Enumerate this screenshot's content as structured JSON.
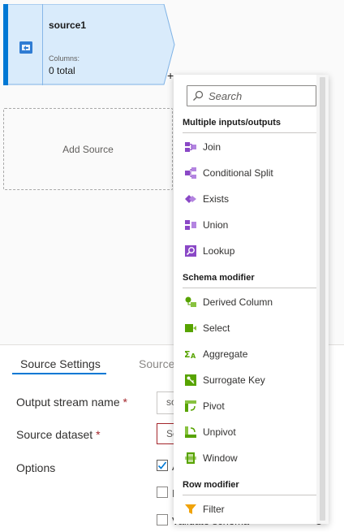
{
  "canvas": {
    "node": {
      "title": "source1",
      "columns_label": "Columns:",
      "columns_value": "0 total"
    },
    "add_node_glyph": "+",
    "add_source_label": "Add Source"
  },
  "settings": {
    "tabs": [
      {
        "label": "Source Settings"
      },
      {
        "label": "Source"
      }
    ],
    "fields": {
      "output_stream_name": {
        "label": "Output stream name",
        "required": "*",
        "value": "so"
      },
      "source_dataset": {
        "label": "Source dataset",
        "required": "*",
        "value": "Se"
      },
      "options": {
        "label": "Options"
      }
    },
    "checkboxes": [
      {
        "label": "A",
        "checked": true
      },
      {
        "label": "I",
        "checked": false
      },
      {
        "label": "Validate schema",
        "checked": false
      }
    ]
  },
  "menu": {
    "search_placeholder": "Search",
    "sections": [
      {
        "header": "Multiple inputs/outputs",
        "items": [
          {
            "label": "Join",
            "icon": "join-icon"
          },
          {
            "label": "Conditional Split",
            "icon": "conditional-split-icon"
          },
          {
            "label": "Exists",
            "icon": "exists-icon"
          },
          {
            "label": "Union",
            "icon": "union-icon"
          },
          {
            "label": "Lookup",
            "icon": "lookup-icon"
          }
        ]
      },
      {
        "header": "Schema modifier",
        "items": [
          {
            "label": "Derived Column",
            "icon": "derived-column-icon"
          },
          {
            "label": "Select",
            "icon": "select-icon"
          },
          {
            "label": "Aggregate",
            "icon": "aggregate-icon"
          },
          {
            "label": "Surrogate Key",
            "icon": "surrogate-key-icon"
          },
          {
            "label": "Pivot",
            "icon": "pivot-icon"
          },
          {
            "label": "Unpivot",
            "icon": "unpivot-icon"
          },
          {
            "label": "Window",
            "icon": "window-icon"
          }
        ]
      },
      {
        "header": "Row modifier",
        "items": [
          {
            "label": "Filter",
            "icon": "filter-icon"
          }
        ]
      }
    ]
  },
  "colors": {
    "accent": "#0078d4",
    "node_fill": "#d9ebfb",
    "purple_icon": "#8a48c6",
    "green_icon": "#57a300",
    "filter_icon": "#f0a30a",
    "error_border": "#a4262c"
  }
}
